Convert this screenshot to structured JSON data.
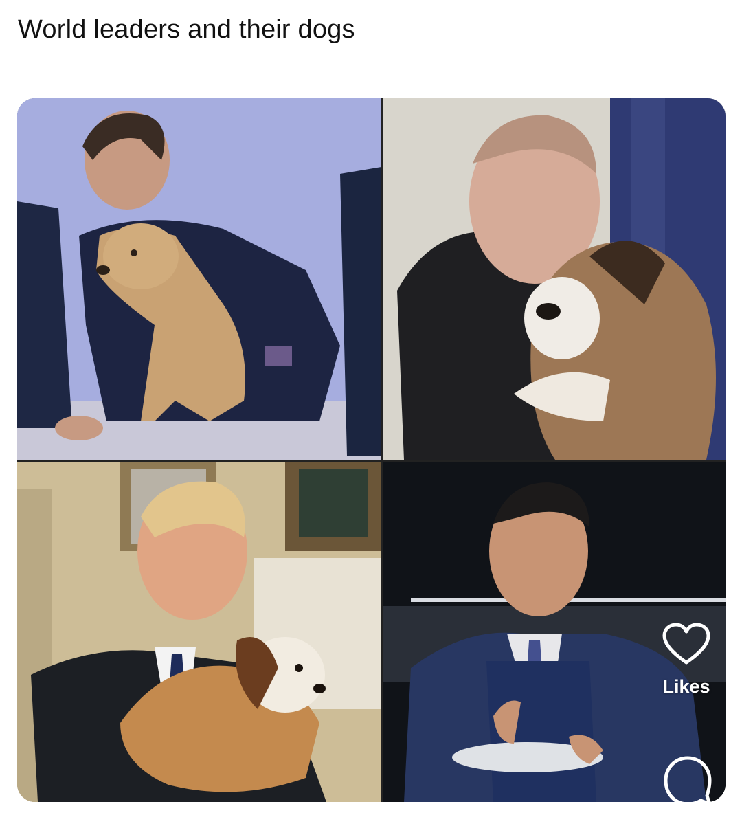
{
  "post": {
    "title": "World leaders and their dogs"
  },
  "actions": {
    "likes_label": "Likes",
    "like_icon": "heart-icon",
    "comment_icon": "comment-icon"
  },
  "colors": {
    "overlay_icon": "#ffffff"
  }
}
